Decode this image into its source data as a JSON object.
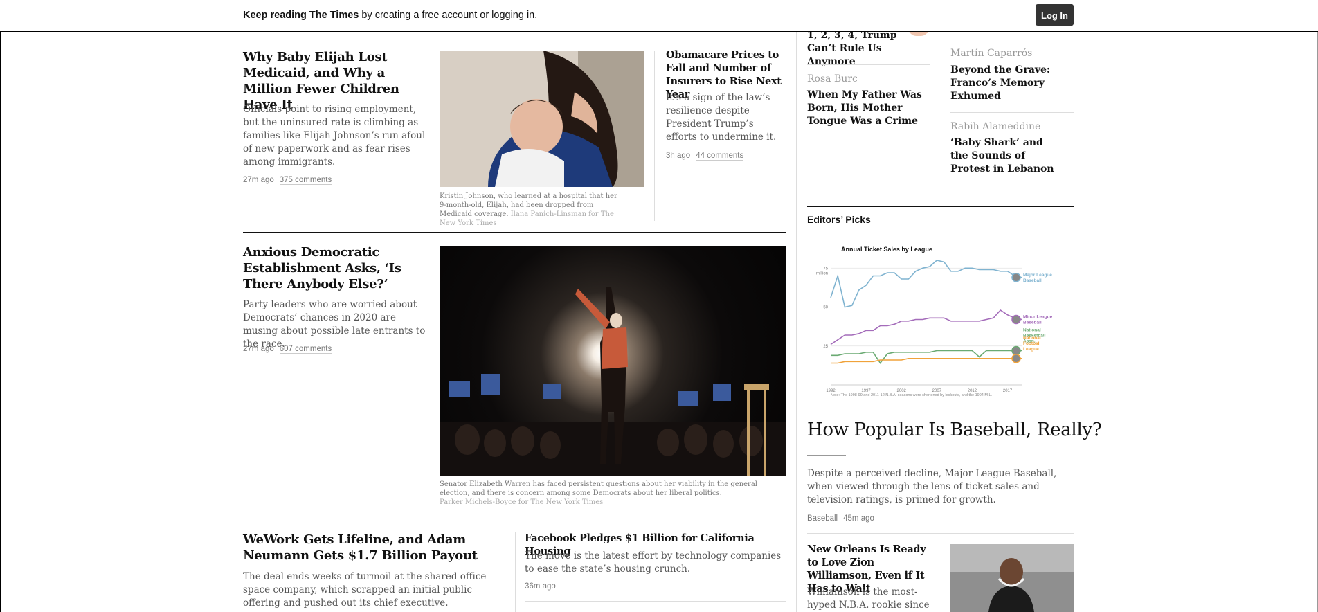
{
  "banner": {
    "bold_text": "Keep reading The Times",
    "rest_text": " by creating a free account or logging in.",
    "login_label": "Log In"
  },
  "stories": {
    "medicaid": {
      "headline": "Why Baby Elijah Lost Medicaid, and Why a Million Fewer Children Have It",
      "summary": "Officials point to rising employment, but the uninsured rate is climbing as families like Elijah Johnson’s run afoul of new paperwork and as fear rises among immigrants.",
      "time": "27m ago",
      "comments": "375 comments",
      "caption": "Kristin Johnson, who learned at a hospital that her 9-month-old, Elijah, had been dropped from Medicaid coverage.",
      "credit": "Ilana Panich-Linsman for The New York Times"
    },
    "obamacare": {
      "headline": "Obamacare Prices to Fall and Number of Insurers to Rise Next Year",
      "summary": "It’s a sign of the law’s resilience despite President Trump’s efforts to undermine it.",
      "time": "3h ago",
      "comments": "44 comments"
    },
    "democrats": {
      "headline": "Anxious Democratic Establishment Asks, ‘Is There Anybody Else?’",
      "summary": "Party leaders who are worried about Democrats’ chances in 2020 are musing about possible late entrants to the race.",
      "time": "27m ago",
      "comments": "607 comments",
      "caption": "Senator Elizabeth Warren has faced persistent questions about her viability in the general election, and there is concern among some Democrats about her liberal politics.",
      "credit": "Parker Michels-Boyce for The New York Times"
    },
    "wework": {
      "headline": "WeWork Gets Lifeline, and Adam Neumann Gets $1.7 Billion Payout",
      "summary": "The deal ends weeks of turmoil at the shared office space company, which scrapped an initial public offering and pushed out its chief executive."
    },
    "facebook": {
      "headline": "Facebook Pledges $1 Billion for California Housing",
      "summary": "The move is the latest effort by technology companies to ease the state’s housing crunch.",
      "time": "36m ago"
    }
  },
  "opinion": {
    "left": [
      {
        "author": "",
        "title": "1, 2, 3, 4, Trump Can’t Rule Us Anymore"
      },
      {
        "author": "Rosa Burc",
        "title": "When My Father Was Born, His Mother Tongue Was a Crime"
      }
    ],
    "right": [
      {
        "author": "Martín Caparrós",
        "title": "Beyond the Grave: Franco’s Memory Exhumed"
      },
      {
        "author": "Rabih Alameddine",
        "title": "‘Baby Shark’ and the Sounds of Protest in Lebanon"
      }
    ]
  },
  "editors_picks": {
    "label": "Editors’ Picks",
    "headline": "How Popular Is Baseball, Really?",
    "summary": "Despite a perceived decline, Major League Baseball, when viewed through the lens of ticket sales and television ratings, is primed for growth.",
    "section": "Baseball",
    "time": "45m ago",
    "second_headline": "New Orleans Is Ready to Love Zion Williamson, Even if It Has to Wait",
    "second_summary": "Williamson is the most-hyped N.B.A. rookie since"
  },
  "chart_data": {
    "type": "line",
    "title": "Annual Ticket Sales by League",
    "xlabel": "",
    "ylabel": "",
    "x": [
      1992,
      1993,
      1994,
      1995,
      1996,
      1997,
      1998,
      1999,
      2000,
      2001,
      2002,
      2003,
      2004,
      2005,
      2006,
      2007,
      2008,
      2009,
      2010,
      2011,
      2012,
      2013,
      2014,
      2015,
      2016,
      2017,
      2018,
      2019
    ],
    "x_ticks": [
      "1992",
      "1997",
      "2002",
      "2007",
      "2012",
      "2017"
    ],
    "y_ticks": [
      "75 million",
      "50",
      "25"
    ],
    "ylim": [
      0,
      80
    ],
    "series": [
      {
        "name": "Major League Baseball",
        "color": "#7fb3d0",
        "values": [
          56,
          70,
          50,
          51,
          61,
          64,
          70,
          70,
          72,
          72,
          68,
          68,
          73,
          75,
          76,
          80,
          79,
          73,
          73,
          75,
          75,
          74,
          74,
          74,
          73,
          73,
          70,
          69
        ]
      },
      {
        "name": "Minor League Baseball",
        "color": "#a46cba",
        "values": [
          26,
          29,
          32,
          32,
          33,
          35,
          35,
          38,
          38,
          39,
          41,
          41,
          42,
          42,
          43,
          43,
          43,
          41,
          41,
          41,
          41,
          41,
          42,
          43,
          48,
          45,
          43,
          42
        ]
      },
      {
        "name": "National Basketball Assn.",
        "color": "#6aaa72",
        "values": [
          19,
          19,
          20,
          20,
          20,
          21,
          21,
          14,
          20,
          21,
          21,
          21,
          21,
          21,
          21,
          22,
          22,
          22,
          22,
          22,
          22,
          18,
          22,
          22,
          22,
          22,
          22,
          22
        ]
      },
      {
        "name": "National Football League",
        "color": "#f0a23a",
        "values": [
          14,
          14,
          15,
          15,
          15,
          15,
          15,
          16,
          16,
          16,
          16,
          17,
          17,
          17,
          17,
          17,
          17,
          17,
          17,
          17,
          17,
          17,
          17,
          17,
          17,
          17,
          17,
          17
        ]
      }
    ],
    "note": "Note: The 1998-99 and 2011-12 N.B.A. seasons were shortened by lockouts, and the 1994 M.L.B. season was shortened by a players’ strike. Sources: ESPN, MiLB.com"
  }
}
